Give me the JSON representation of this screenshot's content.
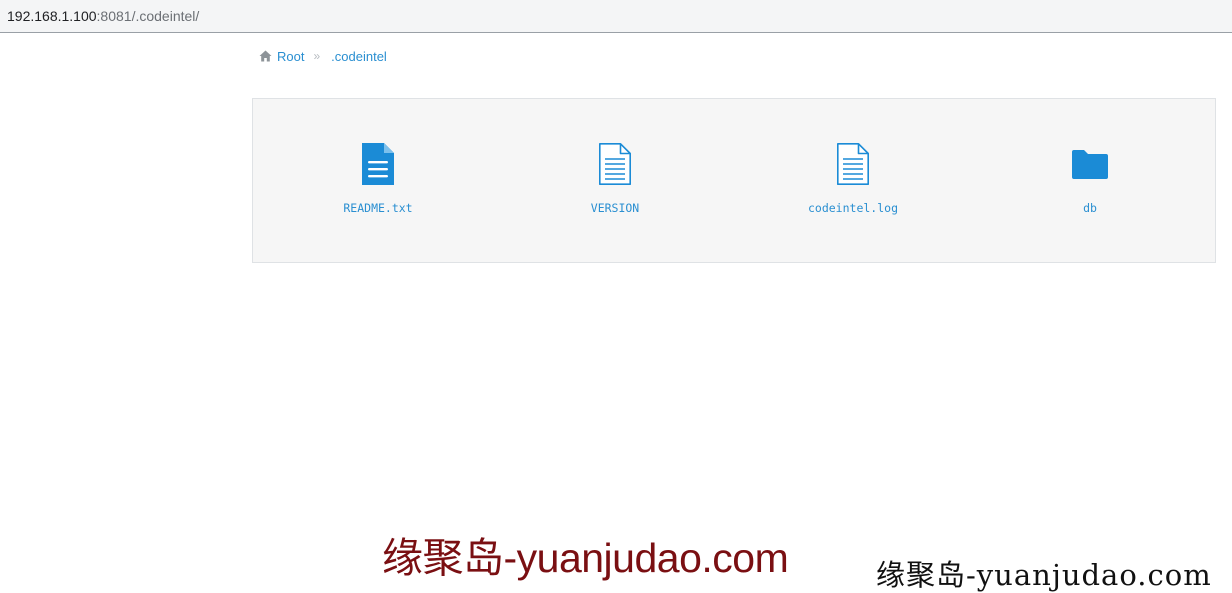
{
  "address_bar": {
    "host": "192.168.1.100",
    "rest": ":8081/.codeintel/"
  },
  "breadcrumb": {
    "root_label": "Root",
    "separator": "»",
    "current_label": ".codeintel",
    "home_icon": "home-icon"
  },
  "files": [
    {
      "name": "README.txt",
      "icon": "file-text-filled-icon"
    },
    {
      "name": "VERSION",
      "icon": "file-text-outline-icon"
    },
    {
      "name": "codeintel.log",
      "icon": "file-text-outline-icon"
    },
    {
      "name": "db",
      "icon": "folder-icon"
    }
  ],
  "colors": {
    "link": "#2a8fd1",
    "panel_bg": "#f6f6f6",
    "watermark": "#7a0f12"
  },
  "watermarks": {
    "primary": "缘聚岛-yuanjudao.com",
    "secondary": "缘聚岛-yuanjudao.com"
  }
}
